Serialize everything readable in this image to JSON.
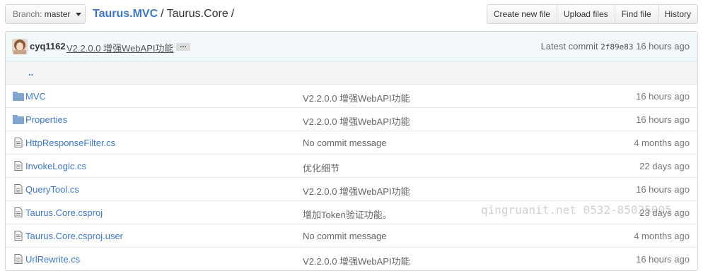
{
  "branch": {
    "prefix": "Branch:",
    "name": "master"
  },
  "breadcrumb": {
    "repo": "Taurus.MVC",
    "separator": "/",
    "folder": "Taurus.Core",
    "trailing": "/"
  },
  "actions": {
    "create": "Create new file",
    "upload": "Upload files",
    "find": "Find file",
    "history": "History"
  },
  "commit": {
    "author": "cyq1162",
    "message": "V2.2.0.0 增强WebAPI功能",
    "ellipsis": "…",
    "latest_label": "Latest commit",
    "sha": "2f89e83",
    "age": "16 hours ago"
  },
  "parent_dir": "..",
  "files": [
    {
      "type": "folder",
      "name": "MVC",
      "message": "V2.2.0.0 增强WebAPI功能",
      "age": "16 hours ago"
    },
    {
      "type": "folder",
      "name": "Properties",
      "message": "V2.2.0.0 增强WebAPI功能",
      "age": "16 hours ago"
    },
    {
      "type": "file",
      "name": "HttpResponseFilter.cs",
      "message": "No commit message",
      "age": "4 months ago"
    },
    {
      "type": "file",
      "name": "InvokeLogic.cs",
      "message": "优化细节",
      "age": "22 days ago"
    },
    {
      "type": "file",
      "name": "QueryTool.cs",
      "message": "V2.2.0.0 增强WebAPI功能",
      "age": "16 hours ago"
    },
    {
      "type": "file",
      "name": "Taurus.Core.csproj",
      "message": "增加Token验证功能。",
      "age": "23 days ago"
    },
    {
      "type": "file",
      "name": "Taurus.Core.csproj.user",
      "message": "No commit message",
      "age": "4 months ago"
    },
    {
      "type": "file",
      "name": "UrlRewrite.cs",
      "message": "V2.2.0.0 增强WebAPI功能",
      "age": "16 hours ago"
    }
  ],
  "watermark": "qingruanit.net 0532-85025005",
  "colors": {
    "link": "#4078c0",
    "folder_icon": "#80a6cd",
    "commit_bg": "#f2f8fa"
  }
}
